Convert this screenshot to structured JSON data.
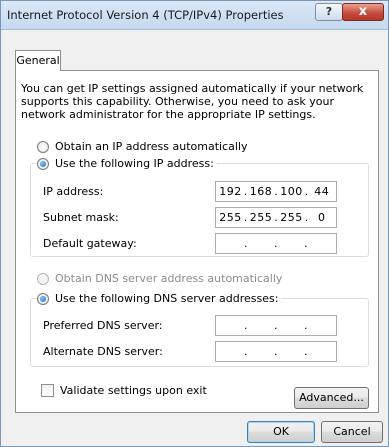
{
  "window": {
    "title": "Internet Protocol Version 4 (TCP/IPv4) Properties"
  },
  "titlebar": {
    "help_label": "?",
    "close_label": "x"
  },
  "tabs": [
    {
      "label": "General"
    }
  ],
  "description": "You can get IP settings assigned automatically if your network supports this capability. Otherwise, you need to ask your network administrator for the appropriate IP settings.",
  "ip": {
    "auto_label": "Obtain an IP address automatically",
    "manual_label": "Use the following IP address:",
    "selected": "manual",
    "fields": [
      {
        "label": "IP address:",
        "octets": [
          "192",
          "168",
          "100",
          "44"
        ]
      },
      {
        "label": "Subnet mask:",
        "octets": [
          "255",
          "255",
          "255",
          "0"
        ]
      },
      {
        "label": "Default gateway:",
        "octets": [
          "",
          "",
          "",
          ""
        ]
      }
    ]
  },
  "dns": {
    "auto_label": "Obtain DNS server address automatically",
    "manual_label": "Use the following DNS server addresses:",
    "selected": "manual",
    "auto_enabled": false,
    "fields": [
      {
        "label": "Preferred DNS server:",
        "octets": [
          "",
          "",
          "",
          ""
        ]
      },
      {
        "label": "Alternate DNS server:",
        "octets": [
          "",
          "",
          "",
          ""
        ]
      }
    ]
  },
  "validate": {
    "label": "Validate settings upon exit",
    "checked": false
  },
  "buttons": {
    "advanced": "Advanced...",
    "ok": "OK",
    "cancel": "Cancel"
  },
  "colors": {
    "titlebar": "#c6d9ef",
    "close_button": "#c5473a",
    "radio_selected": "#1d6fbf"
  }
}
